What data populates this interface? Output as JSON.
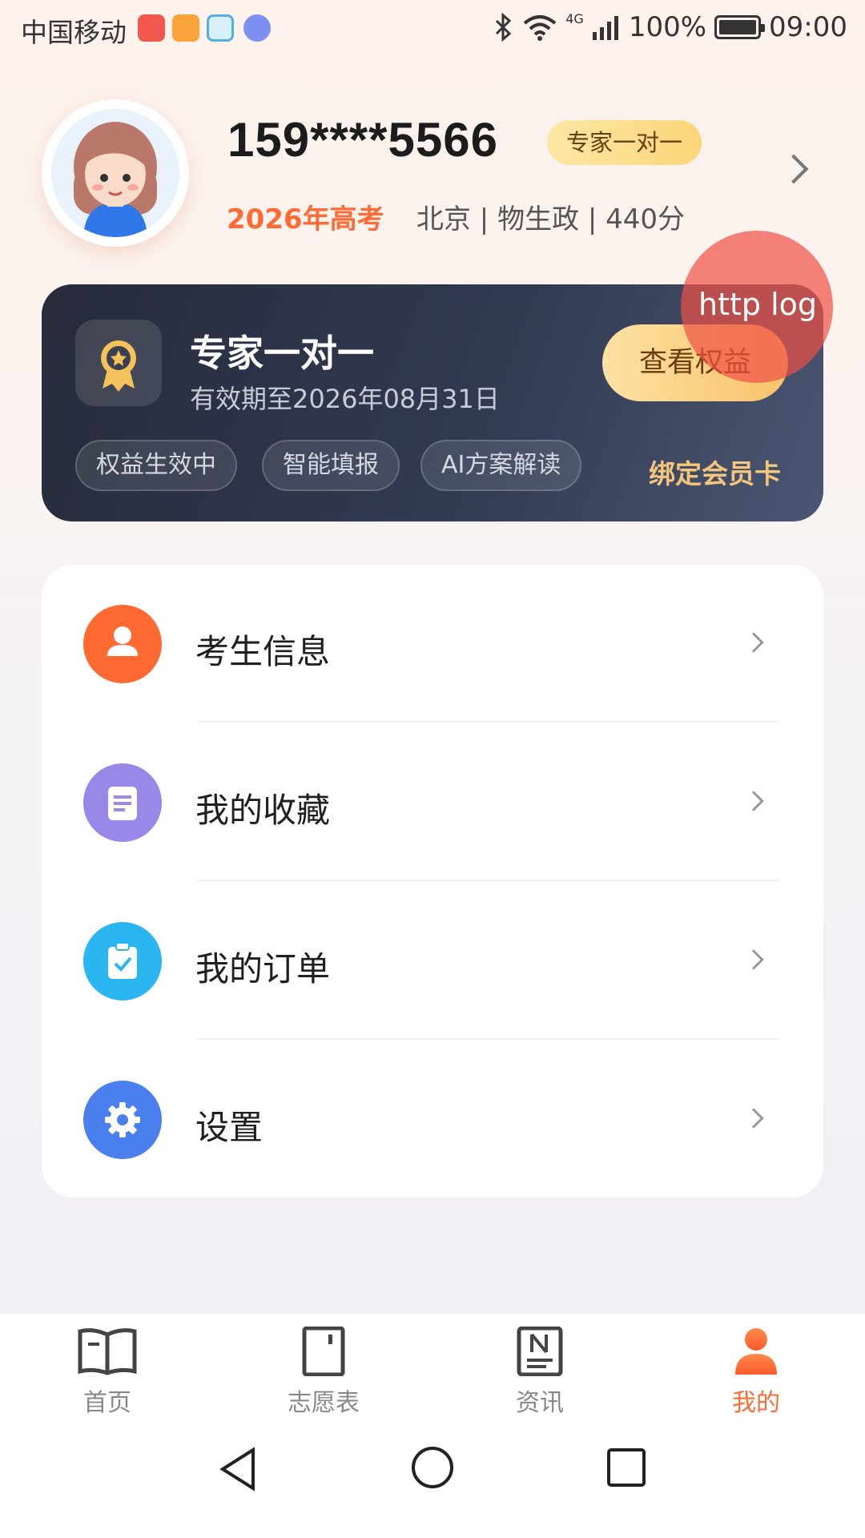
{
  "status_bar": {
    "carrier": "中国移动",
    "network": "4G",
    "battery": "100%",
    "time": "09:00"
  },
  "profile": {
    "phone": "159****5566",
    "badge": "专家一对一",
    "exam_year": "2026年高考",
    "exam_info": "北京 | 物生政 | 440分"
  },
  "membership": {
    "title": "专家一对一",
    "valid_until": "有效期至2026年08月31日",
    "view_button": "查看权益",
    "tags": [
      "权益生效中",
      "智能填报",
      "AI方案解读"
    ],
    "bind_card": "绑定会员卡"
  },
  "overlay": {
    "http_log": "http log"
  },
  "menu": [
    {
      "label": "考生信息",
      "icon": "user-icon",
      "color": "#ff6a33"
    },
    {
      "label": "我的收藏",
      "icon": "document-icon",
      "color": "#9a87ea"
    },
    {
      "label": "我的订单",
      "icon": "clipboard-check-icon",
      "color": "#2bb6f2"
    },
    {
      "label": "设置",
      "icon": "gear-icon",
      "color": "#4b7fef"
    }
  ],
  "tabbar": [
    {
      "label": "首页",
      "icon": "book-icon"
    },
    {
      "label": "志愿表",
      "icon": "door-icon"
    },
    {
      "label": "资讯",
      "icon": "news-icon"
    },
    {
      "label": "我的",
      "icon": "person-icon",
      "active": true
    }
  ],
  "colors": {
    "accent": "#ff6b35",
    "card_dark": "#2c3246",
    "gold": "#f4c57a"
  }
}
